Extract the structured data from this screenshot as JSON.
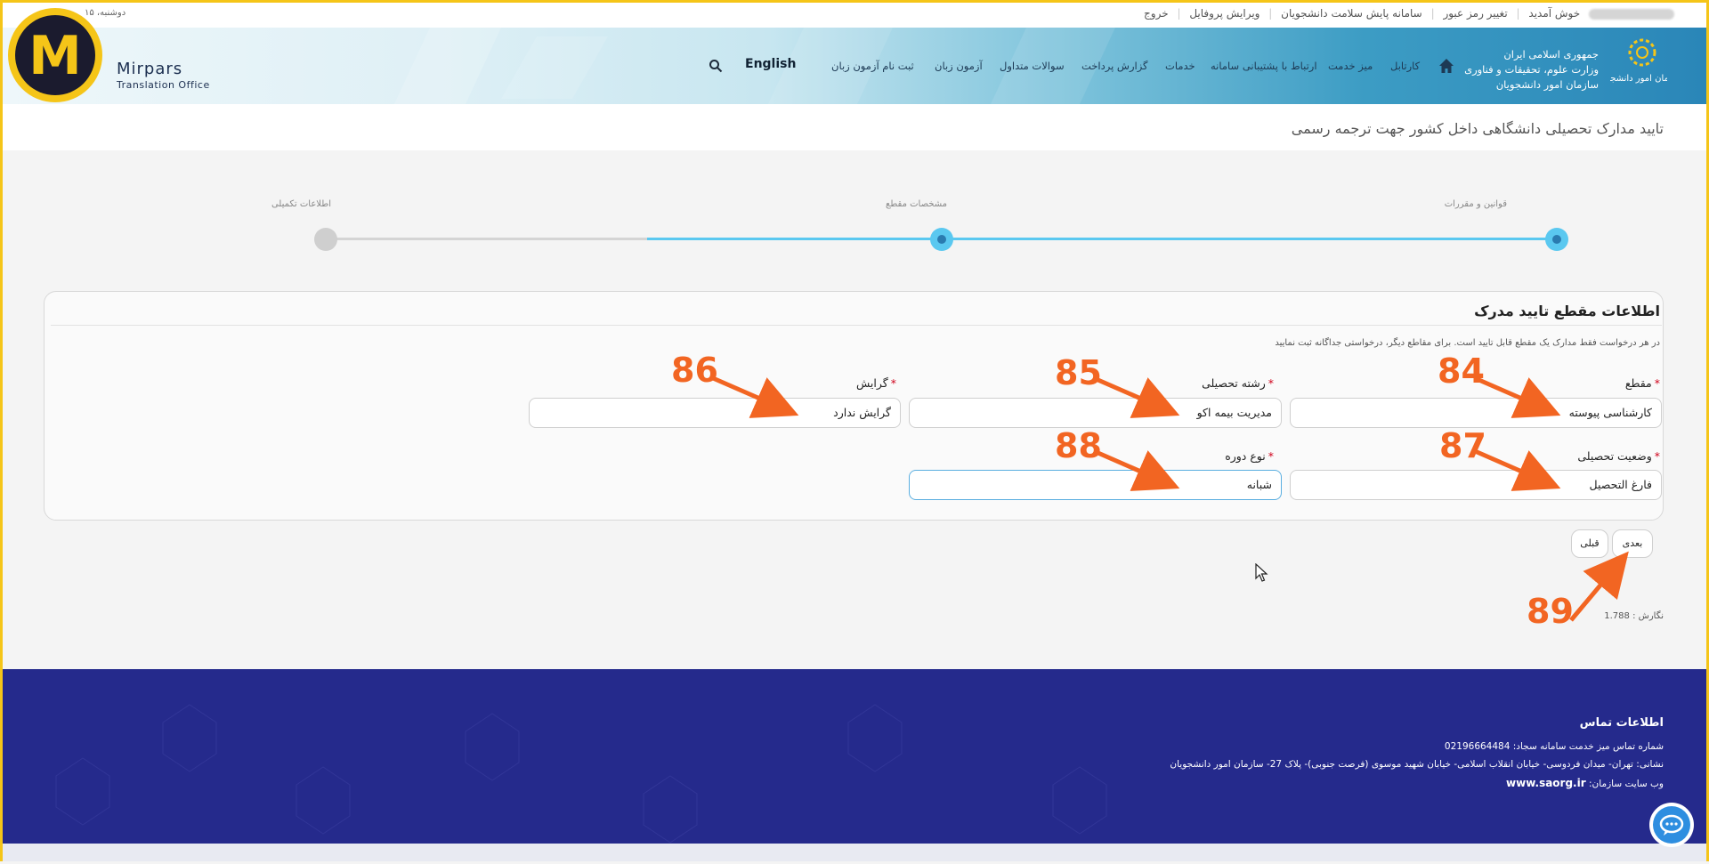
{
  "topbar": {
    "date": "دوشنبه، ۱۵",
    "welcome": "خوش آمدید",
    "change_password": "تغییر رمز عبور",
    "health_system": "سامانه پایش سلامت دانشجویان",
    "edit_profile": "ویرایش پروفایل",
    "logout": "خروج"
  },
  "header": {
    "gov_line1": "جمهوری اسلامی ایران",
    "gov_line2": "وزارت علوم، تحقیقات و فناوری",
    "gov_line3": "سازمان امور دانشجویان",
    "org_logo_text": "سازمان امور دانشجویان",
    "nav": [
      "کارتابل",
      "میز خدمت",
      "ارتباط با پشتیبانی سامانه",
      "خدمات",
      "گزارش پرداخت",
      "سوالات متداول",
      "آزمون زبان",
      "ثبت نام آزمون زبان"
    ],
    "language": "English",
    "icons": [
      "home-icon",
      "search-icon"
    ]
  },
  "watermark": {
    "letter": "M",
    "brand_line1": "Mirpars",
    "brand_line2": "Translation Office"
  },
  "page": {
    "title": "تایید مدارک تحصیلی دانشگاهی داخل کشور جهت ترجمه رسمی"
  },
  "stepper": {
    "steps": [
      {
        "label": "قوانین و مقررات",
        "state": "done"
      },
      {
        "label": "مشخصات مقطع",
        "state": "current"
      },
      {
        "label": "اطلاعات تکمیلی",
        "state": "pending"
      }
    ],
    "active_color": "#5ac8f0"
  },
  "form": {
    "title": "اطلاعات مقطع تایید مدرک",
    "note": "در هر درخواست فقط مدارک یک مقطع قابل تایید است. برای مقاطع دیگر، درخواستی جداگانه ثبت نمایید",
    "fields": {
      "degree": {
        "label": "مقطع",
        "value": "کارشناسی پیوسته"
      },
      "major": {
        "label": "رشته تحصیلی",
        "value": "مدیریت بیمه اکو"
      },
      "orientation": {
        "label": "گرایش",
        "value": "گرایش ندارد"
      },
      "status": {
        "label": "وضعیت تحصیلی",
        "value": "فارغ التحصیل"
      },
      "course_type": {
        "label": "نوع دوره",
        "value": "شبانه"
      }
    },
    "required_mark": "*",
    "next_button": "بعدی",
    "prev_button": "قبلی"
  },
  "version": {
    "label": "نگارش :",
    "value": "1.788"
  },
  "annotations": [
    "84",
    "85",
    "86",
    "87",
    "88",
    "89"
  ],
  "annotation_color": "#f26522",
  "footer": {
    "title": "اطلاعات تماس",
    "phone_label": "شماره تماس میز خدمت سامانه سجاد:",
    "phone": "02196664484",
    "address": "نشانی: تهران- میدان فردوسی- خیابان انقلاب اسلامی- خیابان شهید موسوی (فرصت جنوبی)- پلاک 27- سازمان امور دانشجویان",
    "website_label": "وب سایت سازمان:",
    "website": "www.saorg.ir",
    "background": "#252a8c"
  }
}
